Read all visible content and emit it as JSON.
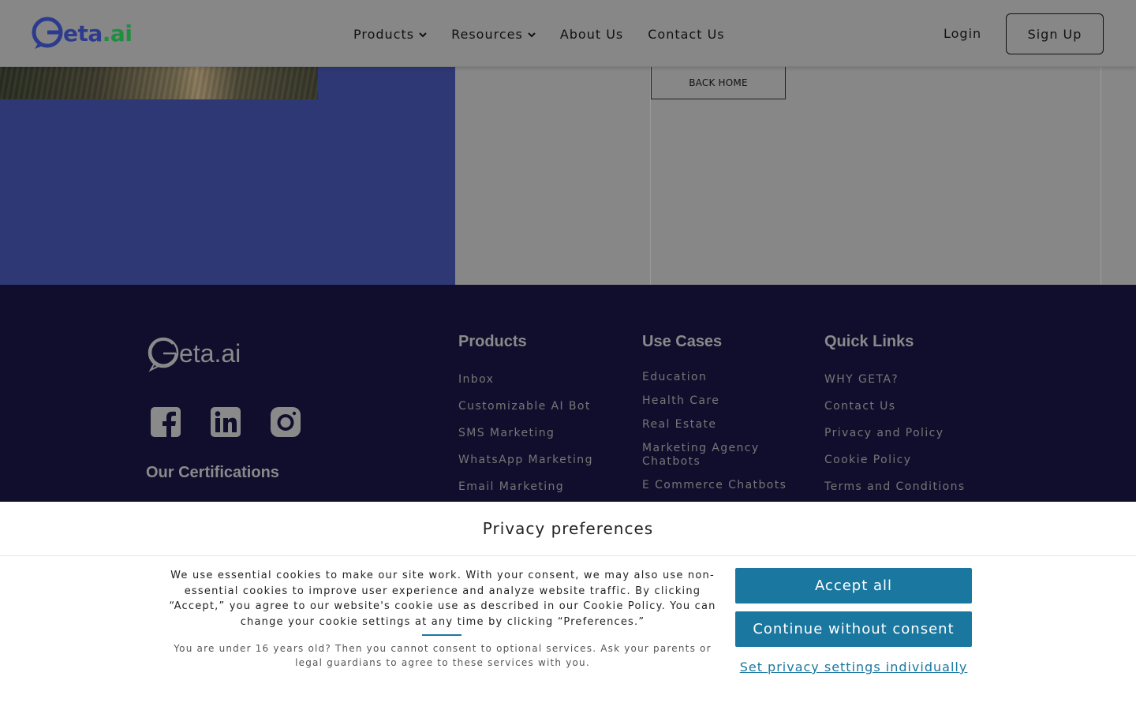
{
  "header": {
    "logo": {
      "mark": "G",
      "text_main": "eta",
      "text_dot": ".ai"
    },
    "nav": [
      {
        "label": "Products",
        "has_dropdown": true
      },
      {
        "label": "Resources",
        "has_dropdown": true
      },
      {
        "label": "About Us",
        "has_dropdown": false
      },
      {
        "label": "Contact Us",
        "has_dropdown": false
      }
    ],
    "login_label": "Login",
    "signup_label": "Sign Up"
  },
  "main": {
    "back_home_label": "BACK HOME"
  },
  "footer": {
    "logo_text": "eta.ai",
    "socials": [
      "facebook-icon",
      "linkedin-icon",
      "instagram-icon"
    ],
    "certifications_title": "Our Certifications",
    "products": {
      "title": "Products",
      "items": [
        "Inbox",
        "Customizable AI Bot",
        "SMS Marketing",
        "WhatsApp Marketing",
        "Email Marketing"
      ]
    },
    "use_cases": {
      "title": "Use Cases",
      "items": [
        "Education",
        "Health Care",
        "Real Estate",
        "Marketing Agency Chatbots",
        "E Commerce Chatbots"
      ]
    },
    "quick_links": {
      "title": "Quick Links",
      "items": [
        "WHY GETA?",
        "Contact Us",
        "Privacy and Policy",
        "Cookie Policy",
        "Terms and Conditions"
      ]
    }
  },
  "privacy": {
    "title": "Privacy preferences",
    "body": "We use essential cookies to make our site work. With your consent, we may also use non-essential cookies to improve user experience and analyze website traffic. By clicking “Accept,” you agree to our website's cookie use as described in our Cookie Policy. You can change your cookie settings at any time by clicking “Preferences.”",
    "age_notice": "You are under 16 years old? Then you cannot consent to optional services. Ask your parents or legal guardians to agree to these services with you.",
    "accept_label": "Accept all",
    "continue_label": "Continue without consent",
    "settings_label": "Set privacy settings individually"
  },
  "colors": {
    "accent": "#1a77a0",
    "brand_blue": "#2d3b8e",
    "brand_green": "#1e8f3e",
    "footer_bg": "#110e2d",
    "overlay_gray": "#878787"
  }
}
